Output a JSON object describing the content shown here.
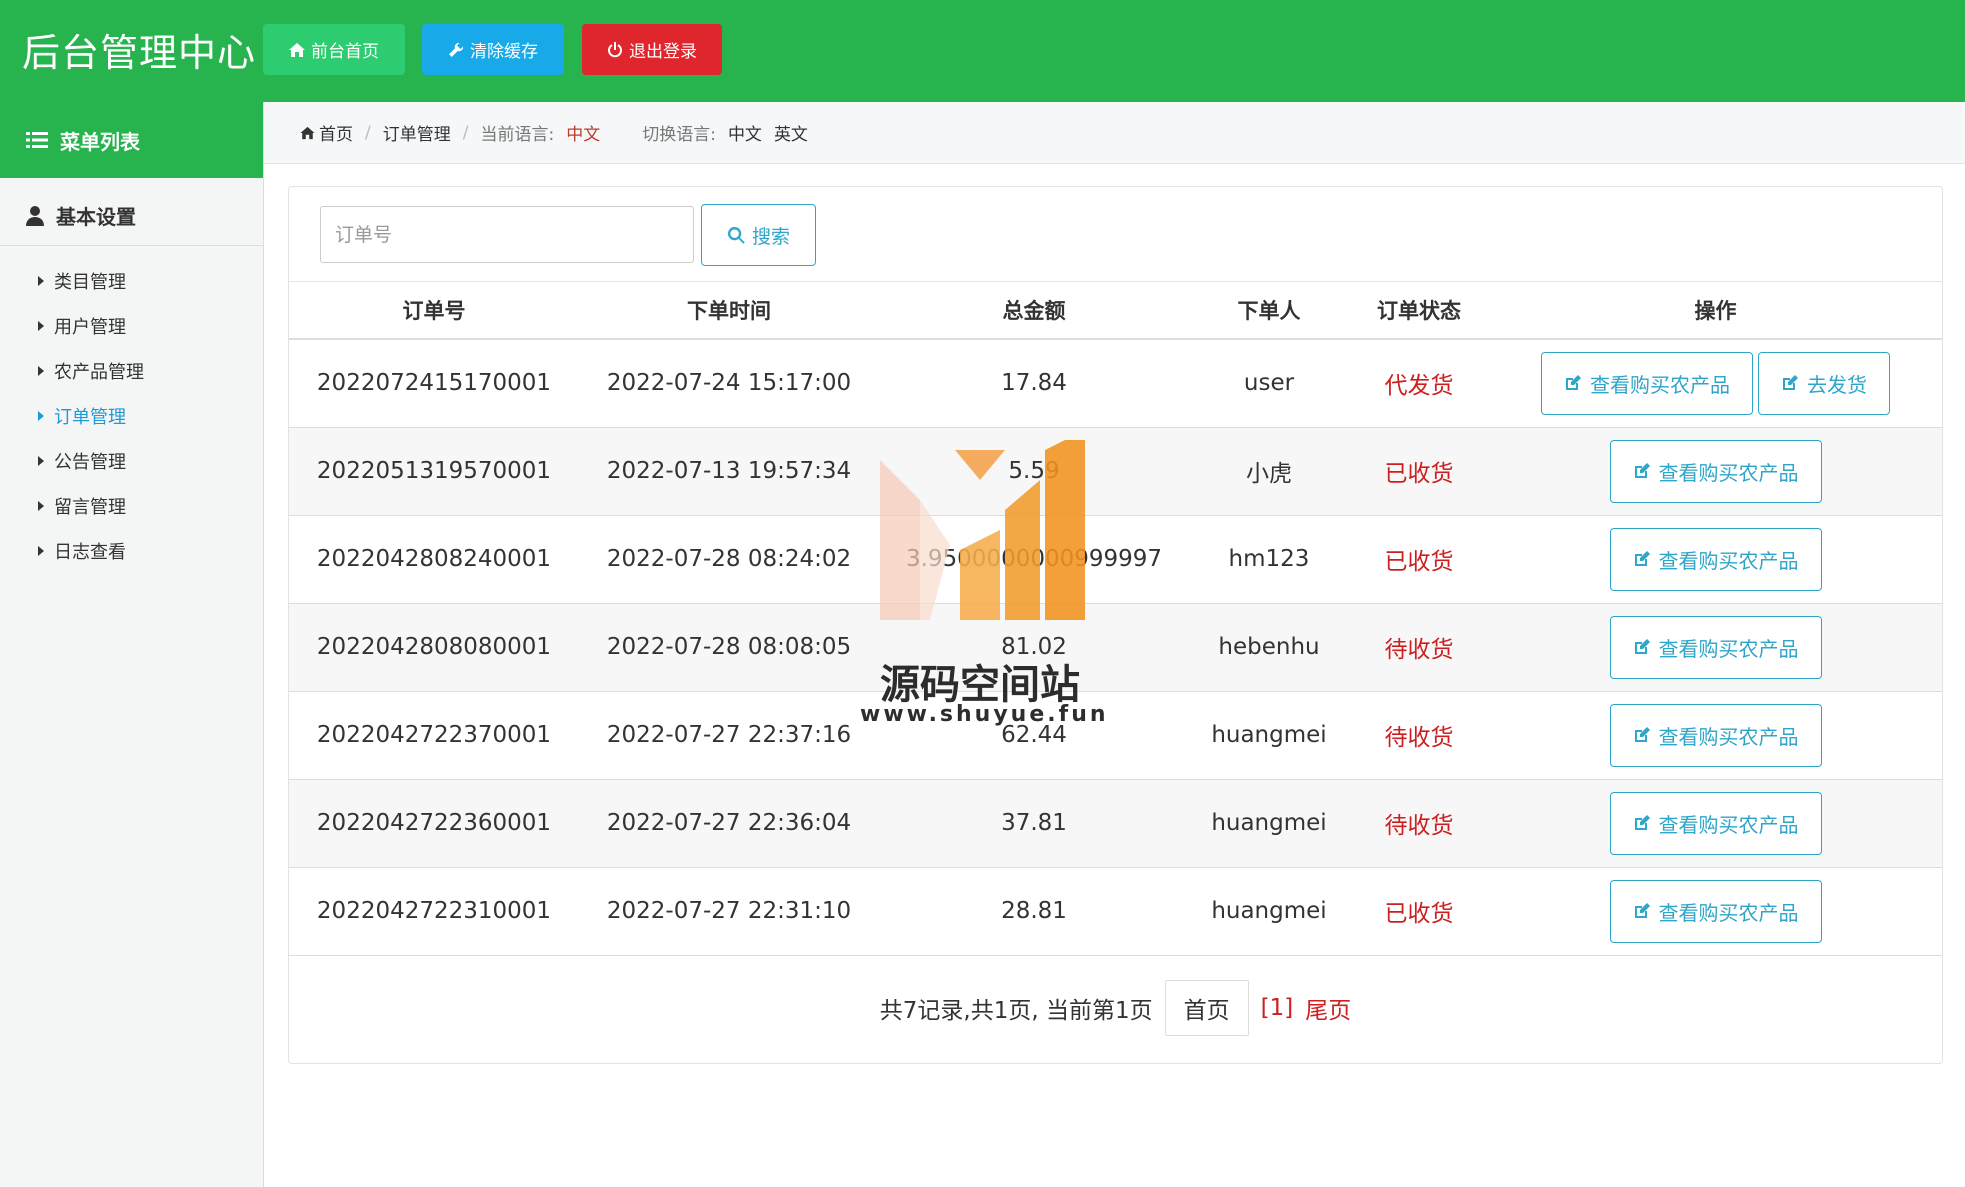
{
  "header": {
    "title": "后台管理中心",
    "buttons": {
      "home": "前台首页",
      "clear_cache": "清除缓存",
      "logout": "退出登录"
    }
  },
  "sidebar": {
    "menu_title": "菜单列表",
    "group_title": "基本设置",
    "items": [
      {
        "label": "类目管理",
        "active": false
      },
      {
        "label": "用户管理",
        "active": false
      },
      {
        "label": "农产品管理",
        "active": false
      },
      {
        "label": "订单管理",
        "active": true
      },
      {
        "label": "公告管理",
        "active": false
      },
      {
        "label": "留言管理",
        "active": false
      },
      {
        "label": "日志查看",
        "active": false
      }
    ]
  },
  "breadcrumb": {
    "home": "首页",
    "current": "订单管理",
    "lang_label": "当前语言:",
    "lang_value": "中文",
    "switch_label": "切换语言:",
    "lang_cn": "中文",
    "lang_en": "英文"
  },
  "search": {
    "placeholder": "订单号",
    "button": "搜索"
  },
  "table": {
    "headers": [
      "订单号",
      "下单时间",
      "总金额",
      "下单人",
      "订单状态",
      "操作"
    ],
    "rows": [
      {
        "order_no": "2022072415170001",
        "time": "2022-07-24 15:17:00",
        "amount": "17.84",
        "user": "user",
        "status": "代发货",
        "actions": [
          "查看购买农产品",
          "去发货"
        ]
      },
      {
        "order_no": "2022051319570001",
        "time": "2022-07-13 19:57:34",
        "amount": "5.59",
        "user": "小虎",
        "status": "已收货",
        "actions": [
          "查看购买农产品"
        ]
      },
      {
        "order_no": "2022042808240001",
        "time": "2022-07-28 08:24:02",
        "amount": "3.9500000000999997",
        "user": "hm123",
        "status": "已收货",
        "actions": [
          "查看购买农产品"
        ]
      },
      {
        "order_no": "2022042808080001",
        "time": "2022-07-28 08:08:05",
        "amount": "81.02",
        "user": "hebenhu",
        "status": "待收货",
        "actions": [
          "查看购买农产品"
        ]
      },
      {
        "order_no": "2022042722370001",
        "time": "2022-07-27 22:37:16",
        "amount": "62.44",
        "user": "huangmei",
        "status": "待收货",
        "actions": [
          "查看购买农产品"
        ]
      },
      {
        "order_no": "2022042722360001",
        "time": "2022-07-27 22:36:04",
        "amount": "37.81",
        "user": "huangmei",
        "status": "待收货",
        "actions": [
          "查看购买农产品"
        ]
      },
      {
        "order_no": "2022042722310001",
        "time": "2022-07-27 22:31:10",
        "amount": "28.81",
        "user": "huangmei",
        "status": "已收货",
        "actions": [
          "查看购买农产品"
        ]
      }
    ]
  },
  "pager": {
    "summary": "共7记录,共1页, 当前第1页",
    "first": "首页",
    "current": "[1]",
    "last": "尾页"
  },
  "watermark": {
    "text": "源码空间站",
    "url": "www.shuyue.fun"
  },
  "colors": {
    "header_green": "#27b34e",
    "accent_blue": "#2da6c9",
    "status_red": "#cc1f1f"
  }
}
